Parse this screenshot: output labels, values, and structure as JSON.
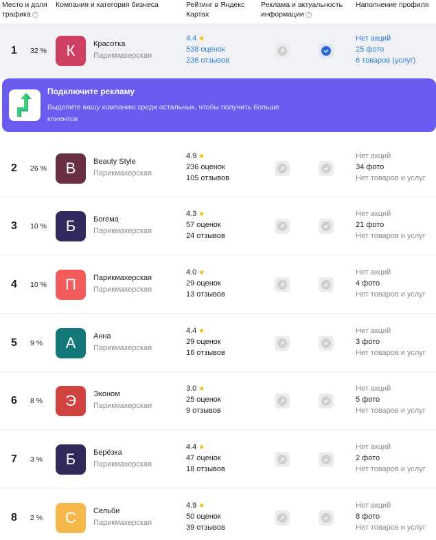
{
  "header": {
    "col_place": "Место и доля трафика",
    "col_company": "Компания и категория бизнеса",
    "col_rating": "Рейтинг в Яндекс Картах",
    "col_ads": "Реклама и актуальность информации",
    "col_profile": "Наполнение профиля"
  },
  "promo": {
    "title": "Подключите рекламу",
    "text": "Выделите вашу компанию среди остальных, чтобы получить больше клиентов"
  },
  "rows": [
    {
      "rank": "1",
      "share": "32 %",
      "letter": "К",
      "color": "#cf3f62",
      "name": "Красотка",
      "category": "Парикмахерская",
      "rating": "4.4",
      "ratings_count": "538 оценок",
      "reviews": "236 отзывов",
      "promo": "Нет акций",
      "photos": "25 фото",
      "goods": "6 товаров (услуг)",
      "highlight": true,
      "verified": true
    },
    {
      "rank": "2",
      "share": "26 %",
      "letter": "B",
      "color": "#6b2f45",
      "name": "Beauty Style",
      "category": "Парикмахерская",
      "rating": "4.9",
      "ratings_count": "236 оценок",
      "reviews": "105 отзывов",
      "promo": "Нет акций",
      "photos": "34 фото",
      "goods": "Нет товаров и услуг"
    },
    {
      "rank": "3",
      "share": "10 %",
      "letter": "Б",
      "color": "#322a5e",
      "name": "Богема",
      "category": "Парикмахерская",
      "rating": "4.3",
      "ratings_count": "57 оценок",
      "reviews": "24 отзывов",
      "promo": "Нет акций",
      "photos": "21 фото",
      "goods": "Нет товаров и услуг"
    },
    {
      "rank": "4",
      "share": "10 %",
      "letter": "П",
      "color": "#f25c5c",
      "name": "Парикмахерская",
      "category": "Парикмахерская",
      "rating": "4.0",
      "ratings_count": "29 оценок",
      "reviews": "13 отзывов",
      "promo": "Нет акций",
      "photos": "4 фото",
      "goods": "Нет товаров и услуг"
    },
    {
      "rank": "5",
      "share": "9 %",
      "letter": "А",
      "color": "#14787a",
      "name": "Анна",
      "category": "Парикмахерская",
      "rating": "4.4",
      "ratings_count": "29 оценок",
      "reviews": "16 отзывов",
      "promo": "Нет акций",
      "photos": "3 фото",
      "goods": "Нет товаров и услуг"
    },
    {
      "rank": "6",
      "share": "8 %",
      "letter": "Э",
      "color": "#d1433f",
      "name": "Эконом",
      "category": "Парикмахерская",
      "rating": "3.0",
      "ratings_count": "25 оценок",
      "reviews": "9 отзывов",
      "promo": "Нет акций",
      "photos": "5 фото",
      "goods": "Нет товаров и услуг"
    },
    {
      "rank": "7",
      "share": "3 %",
      "letter": "Б",
      "color": "#2f2a5a",
      "name": "Берёзка",
      "category": "Парикмахерская",
      "rating": "4.4",
      "ratings_count": "47 оценок",
      "reviews": "18 отзывов",
      "promo": "Нет акций",
      "photos": "2 фото",
      "goods": "Нет товаров и услуг"
    },
    {
      "rank": "8",
      "share": "2 %",
      "letter": "С",
      "color": "#f7b84b",
      "name": "Сельби",
      "category": "Парикмахерская",
      "rating": "4.9",
      "ratings_count": "50 оценок",
      "reviews": "39 отзывов",
      "promo": "Нет акций",
      "photos": "8 фото",
      "goods": "Нет товаров и услуг"
    }
  ]
}
